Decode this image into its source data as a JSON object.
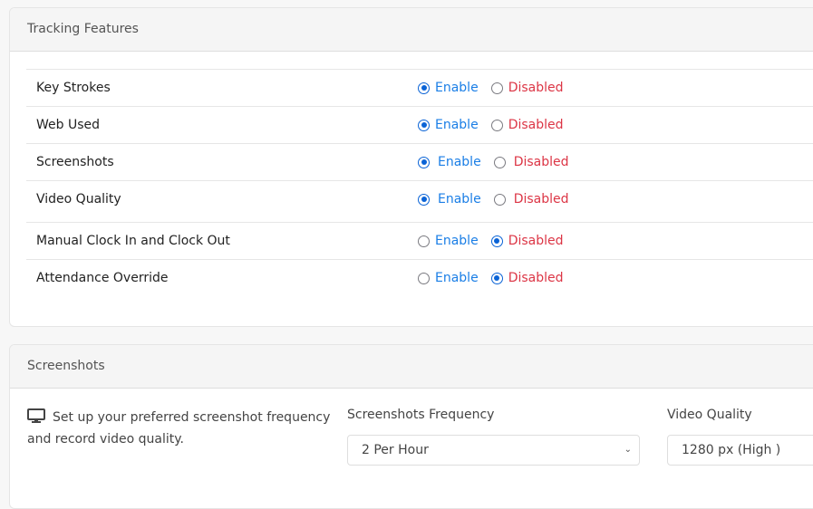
{
  "tracking": {
    "title": "Tracking Features",
    "enable_label": "Enable",
    "disabled_label": "Disabled",
    "features": [
      {
        "label": "Key Strokes",
        "value": "Enable"
      },
      {
        "label": "Web Used",
        "value": "Enable"
      },
      {
        "label": "Screenshots",
        "value": "Enable"
      },
      {
        "label": "Video Quality",
        "value": "Enable"
      },
      {
        "label": "Manual Clock In and Clock Out",
        "value": "Disabled"
      },
      {
        "label": "Attendance Override",
        "value": "Disabled"
      }
    ]
  },
  "screenshots": {
    "title": "Screenshots",
    "icon": "monitor-icon",
    "description": "Set up your preferred screenshot frequency and record video quality.",
    "frequency_label": "Screenshots Frequency",
    "frequency_value": "2 Per Hour",
    "quality_label": "Video Quality",
    "quality_value": "1280 px (High )"
  },
  "colors": {
    "enable": "#1a7ee6",
    "disabled": "#dc3545",
    "radio_selected": "#0a63d6"
  }
}
